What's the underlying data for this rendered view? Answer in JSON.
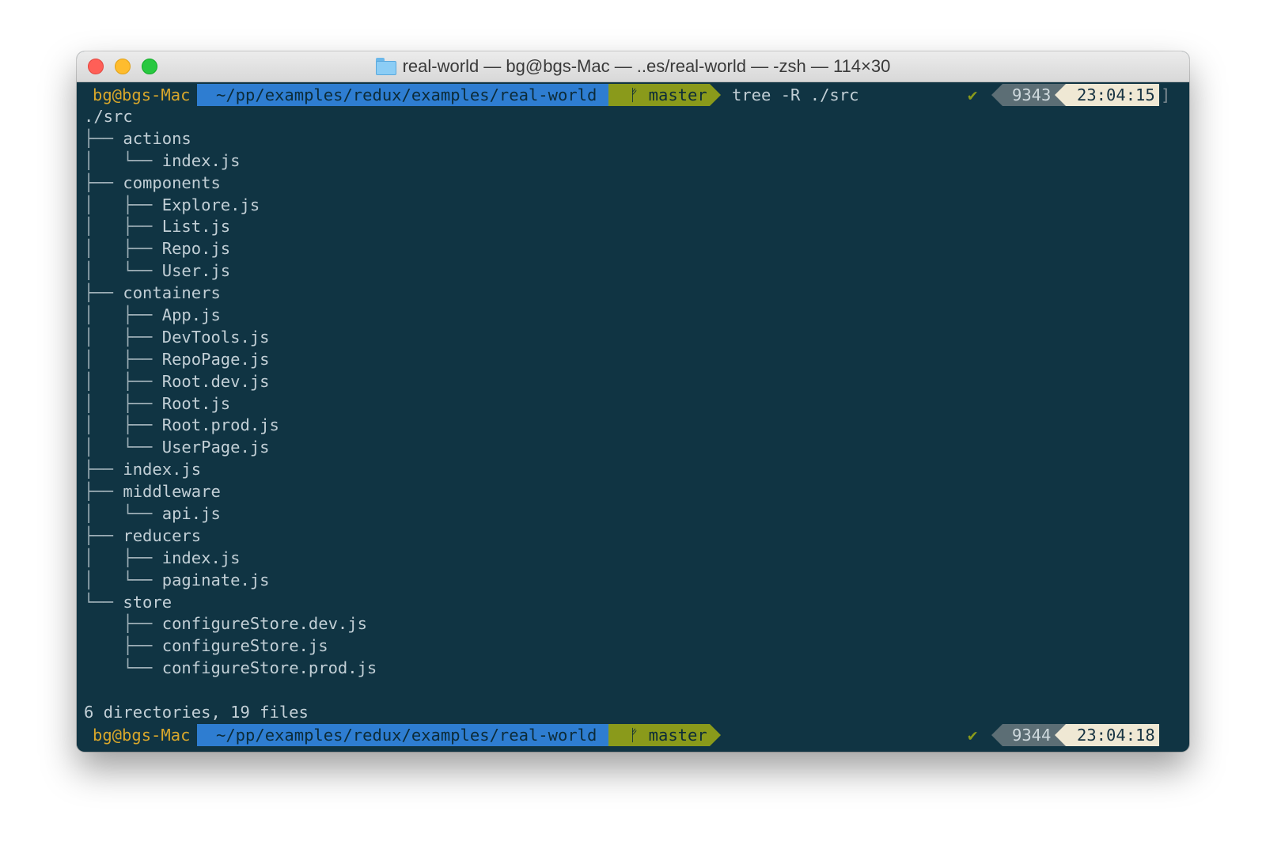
{
  "window": {
    "title": "real-world — bg@bgs-Mac — ..es/real-world — -zsh — 114×30",
    "folder_icon": "folder-icon"
  },
  "prompts": [
    {
      "user": "bg@bgs-Mac",
      "path": "~/pp/examples/redux/examples/real-world",
      "branch_icon": "ᚠ",
      "branch": "master",
      "command": "tree -R ./src",
      "status": "✔",
      "history": "9343",
      "time": "23:04:15",
      "bracket_open": "[",
      "bracket_close": "]"
    },
    {
      "user": "bg@bgs-Mac",
      "path": "~/pp/examples/redux/examples/real-world",
      "branch_icon": "ᚠ",
      "branch": "master",
      "command": "",
      "status": "✔",
      "history": "9344",
      "time": "23:04:18"
    }
  ],
  "tree": [
    {
      "prefix": "",
      "name": "./src"
    },
    {
      "prefix": "├── ",
      "name": "actions"
    },
    {
      "prefix": "│   └── ",
      "name": "index.js"
    },
    {
      "prefix": "├── ",
      "name": "components"
    },
    {
      "prefix": "│   ├── ",
      "name": "Explore.js"
    },
    {
      "prefix": "│   ├── ",
      "name": "List.js"
    },
    {
      "prefix": "│   ├── ",
      "name": "Repo.js"
    },
    {
      "prefix": "│   └── ",
      "name": "User.js"
    },
    {
      "prefix": "├── ",
      "name": "containers"
    },
    {
      "prefix": "│   ├── ",
      "name": "App.js"
    },
    {
      "prefix": "│   ├── ",
      "name": "DevTools.js"
    },
    {
      "prefix": "│   ├── ",
      "name": "RepoPage.js"
    },
    {
      "prefix": "│   ├── ",
      "name": "Root.dev.js"
    },
    {
      "prefix": "│   ├── ",
      "name": "Root.js"
    },
    {
      "prefix": "│   ├── ",
      "name": "Root.prod.js"
    },
    {
      "prefix": "│   └── ",
      "name": "UserPage.js"
    },
    {
      "prefix": "├── ",
      "name": "index.js"
    },
    {
      "prefix": "├── ",
      "name": "middleware"
    },
    {
      "prefix": "│   └── ",
      "name": "api.js"
    },
    {
      "prefix": "├── ",
      "name": "reducers"
    },
    {
      "prefix": "│   ├── ",
      "name": "index.js"
    },
    {
      "prefix": "│   └── ",
      "name": "paginate.js"
    },
    {
      "prefix": "└── ",
      "name": "store"
    },
    {
      "prefix": "    ├── ",
      "name": "configureStore.dev.js"
    },
    {
      "prefix": "    ├── ",
      "name": "configureStore.js"
    },
    {
      "prefix": "    └── ",
      "name": "configureStore.prod.js"
    }
  ],
  "summary": "6 directories, 19 files",
  "colors": {
    "terminal_bg": "#103443",
    "user": "#d9a72b",
    "path_bg": "#2e7dd1",
    "git_bg": "#8a9a1b",
    "history_bg": "#5c6e75",
    "time_bg": "#efe8d4"
  }
}
